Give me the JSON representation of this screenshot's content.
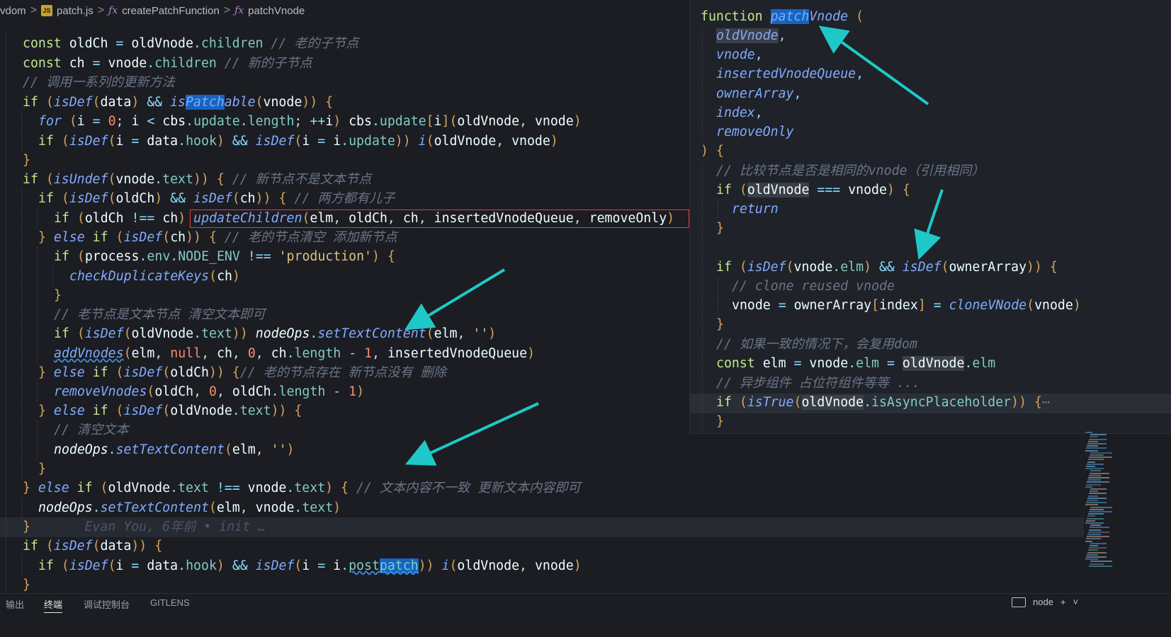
{
  "breadcrumb": {
    "folder": "vdom",
    "file": "patch.js",
    "file_icon": "JS",
    "func1": "createPatchFunction",
    "func2": "patchVnode",
    "fx": "ƒx",
    "sep": ">"
  },
  "editor": {
    "blame": "Evan You, 6年前 • init …",
    "lines": [
      "const oldCh = oldVnode.children // 老的子节点",
      "const ch = vnode.children // 新的子节点",
      "// 调用一系列的更新方法",
      "if (isDef(data) && isPatchable(vnode)) {",
      "for (i = 0; i < cbs.update.length; ++i) cbs.update[i](oldVnode, vnode)",
      "if (isDef(i = data.hook) && isDef(i = i.update)) i(oldVnode, vnode)",
      "}",
      "if (isUndef(vnode.text)) { // 新节点不是文本节点",
      "if (isDef(oldCh) && isDef(ch)) { // 两方都有儿子",
      "if (oldCh !== ch) updateChildren(elm, oldCh, ch, insertedVnodeQueue, removeOnly)",
      "} else if (isDef(ch)) { // 老的节点清空 添加新节点",
      "if (process.env.NODE_ENV !== 'production') {",
      "checkDuplicateKeys(ch)",
      "}",
      "// 老节点是文本节点 清空文本即可",
      "if (isDef(oldVnode.text)) nodeOps.setTextContent(elm, '')",
      "addVnodes(elm, null, ch, 0, ch.length - 1, insertedVnodeQueue)",
      "} else if (isDef(oldCh)) {// 老的节点存在 新节点没有 删除",
      "removeVnodes(oldCh, 0, oldCh.length - 1)",
      "} else if (isDef(oldVnode.text)) {",
      "// 清空文本",
      "nodeOps.setTextContent(elm, '')",
      "}",
      "} else if (oldVnode.text !== vnode.text) { // 文本内容不一致 更新文本内容即可",
      "nodeOps.setTextContent(elm, vnode.text)",
      "}",
      "if (isDef(data)) {",
      "if (isDef(i = data.hook) && isDef(i = i.postpatch)) i(oldVnode, vnode)",
      "}"
    ]
  },
  "peek": {
    "lines": [
      "function patchVnode (",
      "oldVnode,",
      "vnode,",
      "insertedVnodeQueue,",
      "ownerArray,",
      "index,",
      "removeOnly",
      ") {",
      "// 比较节点是否是相同的vnode（引用相同）",
      "if (oldVnode === vnode) {",
      "return",
      "}",
      "",
      "if (isDef(vnode.elm) && isDef(ownerArray)) {",
      "// clone reused vnode",
      "vnode = ownerArray[index] = cloneVNode(vnode)",
      "}",
      "// 如果一致的情况下，会复用dom",
      "const elm = vnode.elm = oldVnode.elm",
      "// 异步组件 占位符组件等等 ...",
      "if (isTrue(oldVnode.isAsyncPlaceholder)) {⋯",
      "}"
    ]
  },
  "panel": {
    "tabs": [
      "输出",
      "终端",
      "调试控制台",
      "GITLENS"
    ],
    "active_tab": "终端",
    "terminal_name": "node",
    "add": "+",
    "dropdown": "˅"
  },
  "colors": {
    "background": "#1b1d23",
    "selection": "#1565c0",
    "annotation_box": "#e04040",
    "arrow": "#1fc8c8"
  },
  "icons": [
    "chevron-right-icon",
    "js-file-icon",
    "function-icon",
    "terminal-icon",
    "plus-icon",
    "chevron-down-icon",
    "arrow-annotation-icon"
  ]
}
